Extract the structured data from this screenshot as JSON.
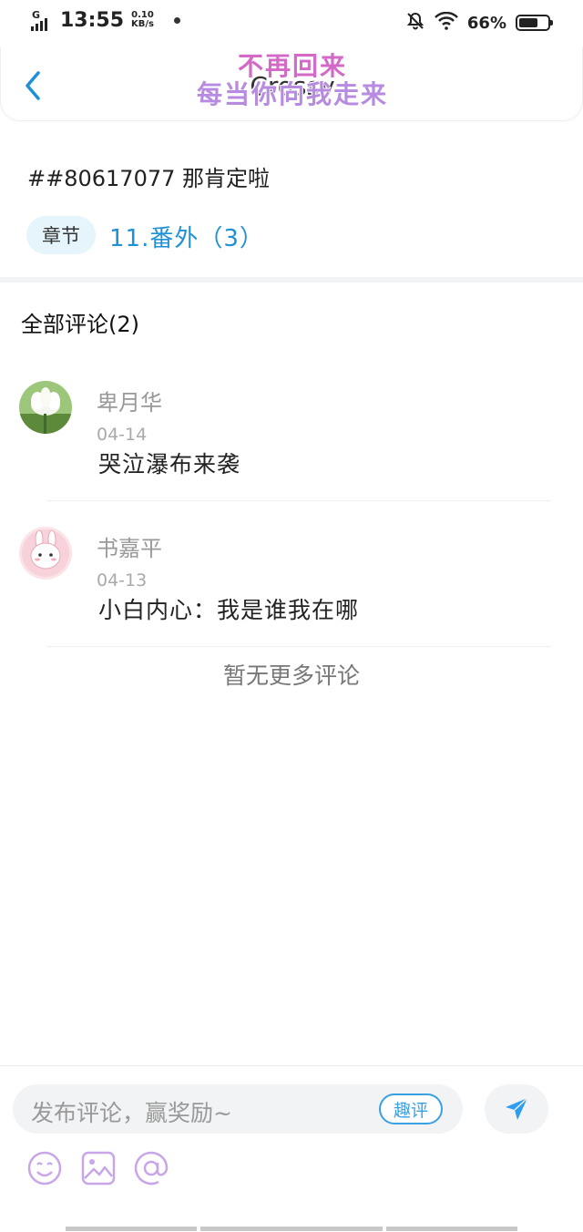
{
  "status_bar": {
    "network_type": "G",
    "time": "13:55",
    "speed_value": "0.10",
    "speed_unit": "KB/s",
    "battery": "66%",
    "battery_level": 0.66,
    "icons": [
      "signal-icon",
      "mute-bell-icon",
      "wifi-icon",
      "battery-icon"
    ]
  },
  "header": {
    "title": "Crossy",
    "overlay_line1": "不再回来",
    "overlay_line2": "每当你向我走来"
  },
  "post": {
    "title": "##80617077 那肯定啦",
    "chapter_tag": "章节",
    "chapter_link": "11.番外（3）"
  },
  "comments_section": {
    "title": "全部评论(2)",
    "items": [
      {
        "user": "卑月华",
        "date": "04-14",
        "text": "哭泣瀑布来袭",
        "avatar": "lotus-avatar"
      },
      {
        "user": "书嘉平",
        "date": "04-13",
        "text": "小白内心：我是谁我在哪",
        "avatar": "bunny-avatar"
      }
    ],
    "no_more": "暂无更多评论"
  },
  "input_bar": {
    "placeholder": "发布评论，赢奖励~",
    "quping_label": "趣评",
    "tools": [
      "emoji-icon",
      "image-icon",
      "at-icon"
    ]
  },
  "colors": {
    "accent": "#1e90d6",
    "tag_bg": "#e6f4fc",
    "tool_purple": "#c8a6e8",
    "send_blue": "#2f9cf0"
  }
}
